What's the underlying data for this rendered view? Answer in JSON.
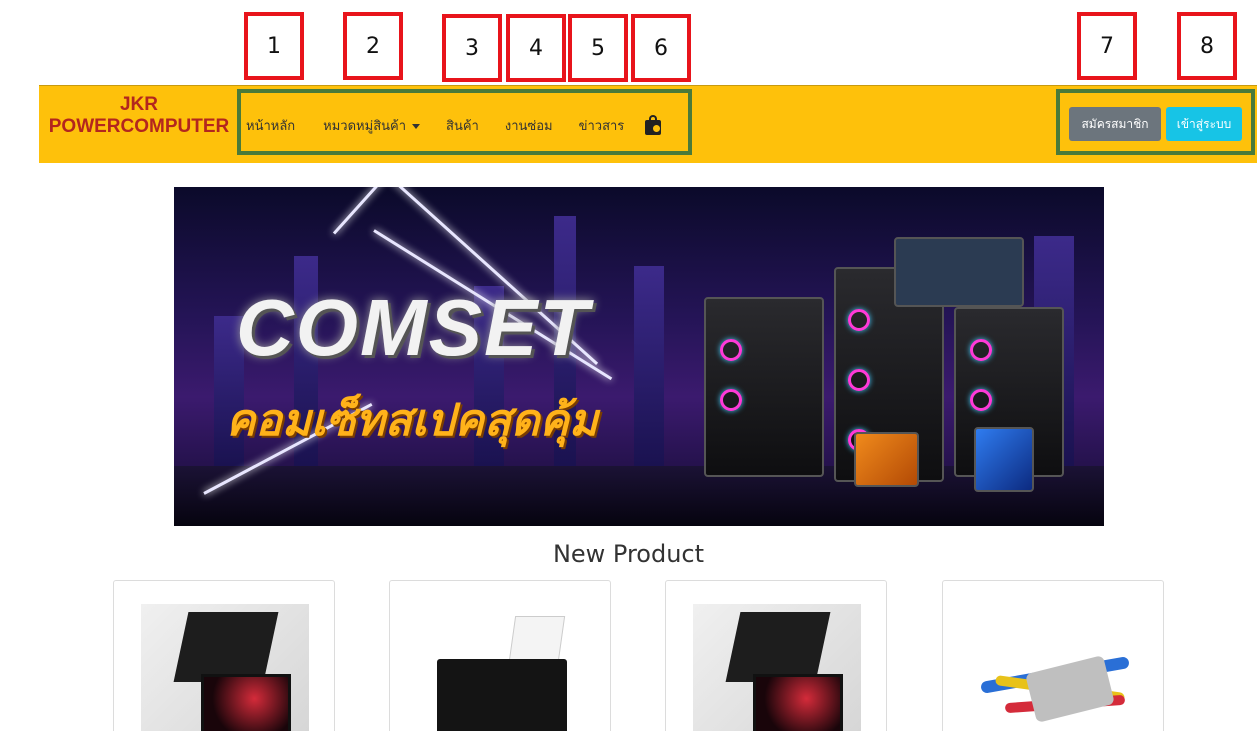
{
  "annotations": [
    "1",
    "2",
    "3",
    "4",
    "5",
    "6",
    "7",
    "8"
  ],
  "navbar": {
    "brand_line1": "JKR",
    "brand_line2": "POWERCOMPUTER",
    "items": [
      {
        "label": "หน้าหลัก"
      },
      {
        "label": "หมวดหมู่สินค้า"
      },
      {
        "label": "สินค้า"
      },
      {
        "label": "งานซ่อม"
      },
      {
        "label": "ข่าวสาร"
      }
    ],
    "cart_icon": "shopping-bag-icon",
    "register_label": "สมัครสมาชิก",
    "login_label": "เข้าสู่ระบบ"
  },
  "banner": {
    "title": "COMSET",
    "subtitle": "คอมเซ็ทสเปคสุดคุ้ม"
  },
  "new_product": {
    "heading": "New Product",
    "cards": [
      {
        "image": "laptop"
      },
      {
        "image": "printer"
      },
      {
        "image": "laptop"
      },
      {
        "image": "av-cables"
      }
    ]
  },
  "colors": {
    "navbar": "#fec10b",
    "brand": "#b3261e",
    "register_button": "#6c757d",
    "login_button": "#17c4e6",
    "annotation_border": "#e8141b",
    "group_border": "#4a7a3a"
  }
}
